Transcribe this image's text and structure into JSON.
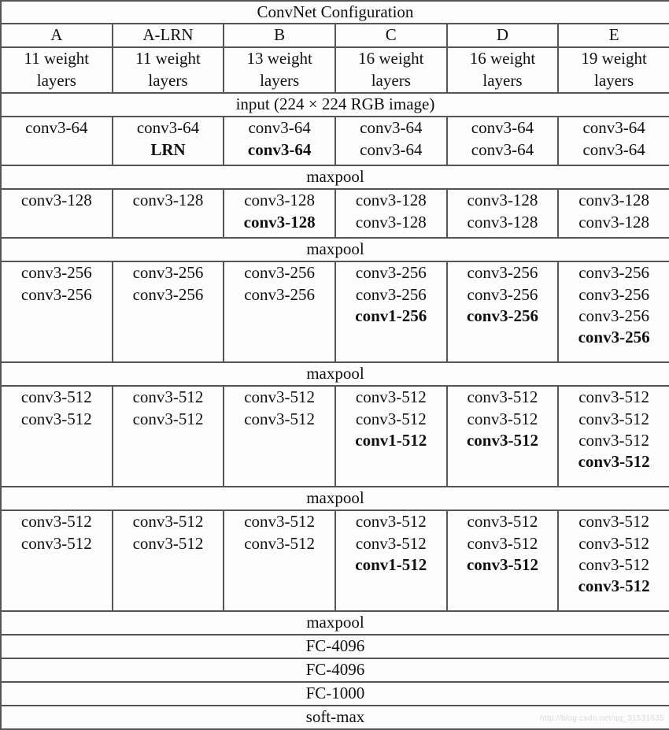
{
  "table": {
    "title": "ConvNet Configuration",
    "columns": [
      {
        "name": "A",
        "weight_layers": "11 weight\nlayers"
      },
      {
        "name": "A-LRN",
        "weight_layers": "11 weight\nlayers"
      },
      {
        "name": "B",
        "weight_layers": "13 weight\nlayers"
      },
      {
        "name": "C",
        "weight_layers": "16 weight\nlayers"
      },
      {
        "name": "D",
        "weight_layers": "16 weight\nlayers"
      },
      {
        "name": "E",
        "weight_layers": "19 weight\nlayers"
      }
    ],
    "column_labels": [
      "A",
      "A-LRN",
      "B",
      "C",
      "D",
      "E"
    ],
    "weight_layer_labels": [
      "11 weight layers",
      "11 weight layers",
      "13 weight layers",
      "16 weight layers",
      "16 weight layers",
      "19 weight layers"
    ],
    "input_row": "input (224 × 224 RGB image)",
    "maxpool_label": "maxpool",
    "blocks": [
      {
        "id": "block-64",
        "columns": [
          {
            "lines": [
              {
                "text": "conv3-64",
                "bold": false
              }
            ]
          },
          {
            "lines": [
              {
                "text": "conv3-64",
                "bold": false
              },
              {
                "text": "LRN",
                "bold": true
              }
            ]
          },
          {
            "lines": [
              {
                "text": "conv3-64",
                "bold": false
              },
              {
                "text": "conv3-64",
                "bold": true
              }
            ]
          },
          {
            "lines": [
              {
                "text": "conv3-64",
                "bold": false
              },
              {
                "text": "conv3-64",
                "bold": false
              }
            ]
          },
          {
            "lines": [
              {
                "text": "conv3-64",
                "bold": false
              },
              {
                "text": "conv3-64",
                "bold": false
              }
            ]
          },
          {
            "lines": [
              {
                "text": "conv3-64",
                "bold": false
              },
              {
                "text": "conv3-64",
                "bold": false
              }
            ]
          }
        ]
      },
      {
        "id": "block-128",
        "columns": [
          {
            "lines": [
              {
                "text": "conv3-128",
                "bold": false
              }
            ]
          },
          {
            "lines": [
              {
                "text": "conv3-128",
                "bold": false
              }
            ]
          },
          {
            "lines": [
              {
                "text": "conv3-128",
                "bold": false
              },
              {
                "text": "conv3-128",
                "bold": true
              }
            ]
          },
          {
            "lines": [
              {
                "text": "conv3-128",
                "bold": false
              },
              {
                "text": "conv3-128",
                "bold": false
              }
            ]
          },
          {
            "lines": [
              {
                "text": "conv3-128",
                "bold": false
              },
              {
                "text": "conv3-128",
                "bold": false
              }
            ]
          },
          {
            "lines": [
              {
                "text": "conv3-128",
                "bold": false
              },
              {
                "text": "conv3-128",
                "bold": false
              }
            ]
          }
        ]
      },
      {
        "id": "block-256",
        "columns": [
          {
            "lines": [
              {
                "text": "conv3-256",
                "bold": false
              },
              {
                "text": "conv3-256",
                "bold": false
              }
            ]
          },
          {
            "lines": [
              {
                "text": "conv3-256",
                "bold": false
              },
              {
                "text": "conv3-256",
                "bold": false
              }
            ]
          },
          {
            "lines": [
              {
                "text": "conv3-256",
                "bold": false
              },
              {
                "text": "conv3-256",
                "bold": false
              }
            ]
          },
          {
            "lines": [
              {
                "text": "conv3-256",
                "bold": false
              },
              {
                "text": "conv3-256",
                "bold": false
              },
              {
                "text": "conv1-256",
                "bold": true
              }
            ]
          },
          {
            "lines": [
              {
                "text": "conv3-256",
                "bold": false
              },
              {
                "text": "conv3-256",
                "bold": false
              },
              {
                "text": "conv3-256",
                "bold": true
              }
            ]
          },
          {
            "lines": [
              {
                "text": "conv3-256",
                "bold": false
              },
              {
                "text": "conv3-256",
                "bold": false
              },
              {
                "text": "conv3-256",
                "bold": false
              },
              {
                "text": "conv3-256",
                "bold": true
              }
            ]
          }
        ]
      },
      {
        "id": "block-512-a",
        "columns": [
          {
            "lines": [
              {
                "text": "conv3-512",
                "bold": false
              },
              {
                "text": "conv3-512",
                "bold": false
              }
            ]
          },
          {
            "lines": [
              {
                "text": "conv3-512",
                "bold": false
              },
              {
                "text": "conv3-512",
                "bold": false
              }
            ]
          },
          {
            "lines": [
              {
                "text": "conv3-512",
                "bold": false
              },
              {
                "text": "conv3-512",
                "bold": false
              }
            ]
          },
          {
            "lines": [
              {
                "text": "conv3-512",
                "bold": false
              },
              {
                "text": "conv3-512",
                "bold": false
              },
              {
                "text": "conv1-512",
                "bold": true
              }
            ]
          },
          {
            "lines": [
              {
                "text": "conv3-512",
                "bold": false
              },
              {
                "text": "conv3-512",
                "bold": false
              },
              {
                "text": "conv3-512",
                "bold": true
              }
            ]
          },
          {
            "lines": [
              {
                "text": "conv3-512",
                "bold": false
              },
              {
                "text": "conv3-512",
                "bold": false
              },
              {
                "text": "conv3-512",
                "bold": false
              },
              {
                "text": "conv3-512",
                "bold": true
              }
            ]
          }
        ]
      },
      {
        "id": "block-512-b",
        "columns": [
          {
            "lines": [
              {
                "text": "conv3-512",
                "bold": false
              },
              {
                "text": "conv3-512",
                "bold": false
              }
            ]
          },
          {
            "lines": [
              {
                "text": "conv3-512",
                "bold": false
              },
              {
                "text": "conv3-512",
                "bold": false
              }
            ]
          },
          {
            "lines": [
              {
                "text": "conv3-512",
                "bold": false
              },
              {
                "text": "conv3-512",
                "bold": false
              }
            ]
          },
          {
            "lines": [
              {
                "text": "conv3-512",
                "bold": false
              },
              {
                "text": "conv3-512",
                "bold": false
              },
              {
                "text": "conv1-512",
                "bold": true
              }
            ]
          },
          {
            "lines": [
              {
                "text": "conv3-512",
                "bold": false
              },
              {
                "text": "conv3-512",
                "bold": false
              },
              {
                "text": "conv3-512",
                "bold": true
              }
            ]
          },
          {
            "lines": [
              {
                "text": "conv3-512",
                "bold": false
              },
              {
                "text": "conv3-512",
                "bold": false
              },
              {
                "text": "conv3-512",
                "bold": false
              },
              {
                "text": "conv3-512",
                "bold": true
              }
            ]
          }
        ]
      }
    ],
    "footer_rows": [
      "maxpool",
      "FC-4096",
      "FC-4096",
      "FC-1000",
      "soft-max"
    ]
  },
  "watermark": "http://blog.csdn.net/qq_31531635",
  "colors": {
    "border": "#555555",
    "background": "#fdfdfd",
    "text": "#101010"
  }
}
